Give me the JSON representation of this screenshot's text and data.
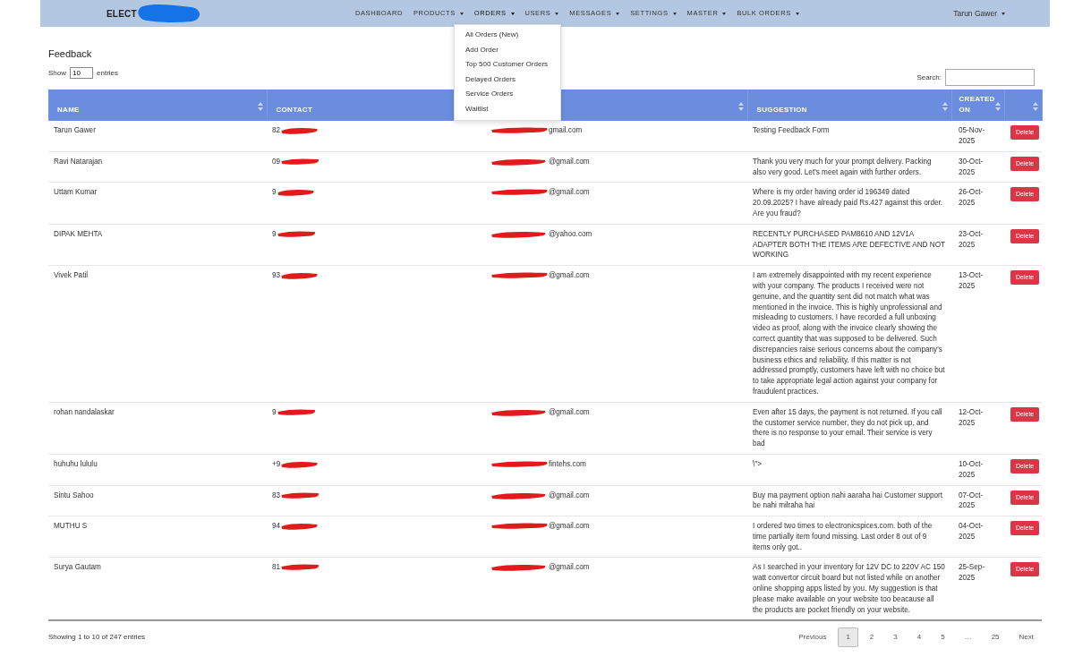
{
  "navbar": {
    "brand": "ELECT",
    "menu": [
      {
        "label": "DASHBOARD",
        "dropdown": false,
        "expanded": false
      },
      {
        "label": "PRODUCTS",
        "dropdown": true,
        "expanded": false
      },
      {
        "label": "ORDERS",
        "dropdown": true,
        "expanded": true
      },
      {
        "label": "USERS",
        "dropdown": true,
        "expanded": false
      },
      {
        "label": "MESSAGES",
        "dropdown": true,
        "expanded": false
      },
      {
        "label": "SETTINGS",
        "dropdown": true,
        "expanded": false
      },
      {
        "label": "MASTER",
        "dropdown": true,
        "expanded": false
      },
      {
        "label": "BULK ORDERS",
        "dropdown": true,
        "expanded": false
      }
    ],
    "user": "Tarun Gawer"
  },
  "orders_menu": [
    "All Orders (New)",
    "Add Order",
    "Top 500 Customer Orders",
    "Delayed Orders",
    "Service Orders",
    "Waitlist"
  ],
  "page_title": "Feedback",
  "length": {
    "before": "Show",
    "value": "10",
    "after": "entries"
  },
  "search": {
    "label": "Search:"
  },
  "table": {
    "columns": [
      "NAME",
      "CONTACT",
      "",
      "SUGGESTION",
      "CREATED ON",
      ""
    ],
    "rows": [
      {
        "name": "Tarun Gawer",
        "contact": "82",
        "email": "gmail.com",
        "suggestion": "Testing Feedback Form",
        "created_on": "05-Nov-2025",
        "action": "Delete"
      },
      {
        "name": "Ravi Natarajan",
        "contact": "09",
        "email": "@gmail.com",
        "suggestion": "Thank you very much for your prompt delivery. Packing also very good. Let's meet again with further orders.",
        "created_on": "30-Oct-2025",
        "action": "Delete"
      },
      {
        "name": "Uttam Kumar",
        "contact": "9",
        "email": "@gmail.com",
        "suggestion": "Where is my order having order id 196349 dated 20.09.2025? I have already paid Rs.427 against this order. Are you fraud?",
        "created_on": "26-Oct-2025",
        "action": "Delete"
      },
      {
        "name": "DIPAK MEHTA",
        "contact": "9",
        "email": "@yahoo.com",
        "suggestion": "RECENTLY PURCHASED PAM8610 AND 12V1A ADAPTER BOTH THE ITEMS ARE DEFECTIVE AND NOT WORKING",
        "created_on": "23-Oct-2025",
        "action": "Delete"
      },
      {
        "name": "Vivek Patil",
        "contact": "93",
        "email": "@gmail.com",
        "suggestion": "I am extremely disappointed with my recent experience with your company. The products I received were not genuine, and the quantity sent did not match what was mentioned in the invoice. This is highly unprofessional and misleading to customers. I have recorded a full unboxing video as proof, along with the invoice clearly showing the correct quantity that was supposed to be delivered. Such discrepancies raise serious concerns about the company's business ethics and reliability. If this matter is not addressed promptly, customers have left with no choice but to take appropriate legal action against your company for fraudulent practices.",
        "created_on": "13-Oct-2025",
        "action": "Delete"
      },
      {
        "name": "rohan nandalaskar",
        "contact": "9",
        "email": "@gmail.com",
        "suggestion": "Even after 15 days, the payment is not returned. If you call the customer service number, they do not pick up, and there is no response to your email. Their service is very bad",
        "created_on": "12-Oct-2025",
        "action": "Delete"
      },
      {
        "name": "huhuhu lululu",
        "contact": "+9",
        "email": "fintehs.com",
        "suggestion": "\\\">",
        "created_on": "10-Oct-2025",
        "action": "Delete"
      },
      {
        "name": "Sintu Sahoo",
        "contact": "83",
        "email": "@gmail.com",
        "suggestion": "Buy ma payment option nahi aaraha hai Customer support be nahi milraha hai",
        "created_on": "07-Oct-2025",
        "action": "Delete"
      },
      {
        "name": "MUTHU S",
        "contact": "94",
        "email": "@gmail.com",
        "suggestion": "I ordered two times to electronicspices.com. both of the time partially item found missing. Last order 8 out of 9 items only got..",
        "created_on": "04-Oct-2025",
        "action": "Delete"
      },
      {
        "name": "Surya Gautam",
        "contact": "81",
        "email": "@gmail.com",
        "suggestion": "As I searched in your inventory for 12V DC to 220V AC 150 watt convertor circuit board but not listed while on another online shopping apps listed by you. My suggestion is that please make available on your website too beacause all the products are pocket friendly on your website.",
        "created_on": "25-Sep-2025",
        "action": "Delete"
      }
    ]
  },
  "info": "Showing 1 to 10 of 247 entries",
  "pagination": [
    {
      "label": "Previous",
      "selected": false
    },
    {
      "label": "1",
      "selected": true
    },
    {
      "label": "2",
      "selected": false
    },
    {
      "label": "3",
      "selected": false
    },
    {
      "label": "4",
      "selected": false
    },
    {
      "label": "5",
      "selected": false
    },
    {
      "label": "…",
      "selected": false
    },
    {
      "label": "25",
      "selected": false
    },
    {
      "label": "Next",
      "selected": false
    }
  ]
}
